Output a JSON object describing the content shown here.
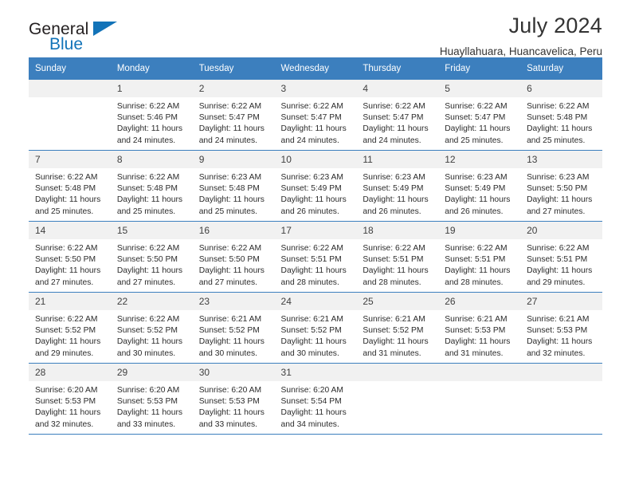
{
  "brand": {
    "name_top": "General",
    "name_bottom": "Blue",
    "flag_color": "#1273b8",
    "icon": "triangle-flag-icon"
  },
  "header": {
    "title": "July 2024",
    "subtitle": "Huayllahuara, Huancavelica, Peru"
  },
  "calendar": {
    "accent_color": "#3c7fbe",
    "daynum_background": "#f1f1f1",
    "weekday_headers": [
      "Sunday",
      "Monday",
      "Tuesday",
      "Wednesday",
      "Thursday",
      "Friday",
      "Saturday"
    ],
    "weeks": [
      [
        {
          "day": "",
          "blank": true,
          "sunrise": "",
          "sunset": "",
          "daylight_line1": "",
          "daylight_line2": ""
        },
        {
          "day": "1",
          "sunrise": "Sunrise: 6:22 AM",
          "sunset": "Sunset: 5:46 PM",
          "daylight_line1": "Daylight: 11 hours",
          "daylight_line2": "and 24 minutes."
        },
        {
          "day": "2",
          "sunrise": "Sunrise: 6:22 AM",
          "sunset": "Sunset: 5:47 PM",
          "daylight_line1": "Daylight: 11 hours",
          "daylight_line2": "and 24 minutes."
        },
        {
          "day": "3",
          "sunrise": "Sunrise: 6:22 AM",
          "sunset": "Sunset: 5:47 PM",
          "daylight_line1": "Daylight: 11 hours",
          "daylight_line2": "and 24 minutes."
        },
        {
          "day": "4",
          "sunrise": "Sunrise: 6:22 AM",
          "sunset": "Sunset: 5:47 PM",
          "daylight_line1": "Daylight: 11 hours",
          "daylight_line2": "and 24 minutes."
        },
        {
          "day": "5",
          "sunrise": "Sunrise: 6:22 AM",
          "sunset": "Sunset: 5:47 PM",
          "daylight_line1": "Daylight: 11 hours",
          "daylight_line2": "and 25 minutes."
        },
        {
          "day": "6",
          "sunrise": "Sunrise: 6:22 AM",
          "sunset": "Sunset: 5:48 PM",
          "daylight_line1": "Daylight: 11 hours",
          "daylight_line2": "and 25 minutes."
        }
      ],
      [
        {
          "day": "7",
          "sunrise": "Sunrise: 6:22 AM",
          "sunset": "Sunset: 5:48 PM",
          "daylight_line1": "Daylight: 11 hours",
          "daylight_line2": "and 25 minutes."
        },
        {
          "day": "8",
          "sunrise": "Sunrise: 6:22 AM",
          "sunset": "Sunset: 5:48 PM",
          "daylight_line1": "Daylight: 11 hours",
          "daylight_line2": "and 25 minutes."
        },
        {
          "day": "9",
          "sunrise": "Sunrise: 6:23 AM",
          "sunset": "Sunset: 5:48 PM",
          "daylight_line1": "Daylight: 11 hours",
          "daylight_line2": "and 25 minutes."
        },
        {
          "day": "10",
          "sunrise": "Sunrise: 6:23 AM",
          "sunset": "Sunset: 5:49 PM",
          "daylight_line1": "Daylight: 11 hours",
          "daylight_line2": "and 26 minutes."
        },
        {
          "day": "11",
          "sunrise": "Sunrise: 6:23 AM",
          "sunset": "Sunset: 5:49 PM",
          "daylight_line1": "Daylight: 11 hours",
          "daylight_line2": "and 26 minutes."
        },
        {
          "day": "12",
          "sunrise": "Sunrise: 6:23 AM",
          "sunset": "Sunset: 5:49 PM",
          "daylight_line1": "Daylight: 11 hours",
          "daylight_line2": "and 26 minutes."
        },
        {
          "day": "13",
          "sunrise": "Sunrise: 6:23 AM",
          "sunset": "Sunset: 5:50 PM",
          "daylight_line1": "Daylight: 11 hours",
          "daylight_line2": "and 27 minutes."
        }
      ],
      [
        {
          "day": "14",
          "sunrise": "Sunrise: 6:22 AM",
          "sunset": "Sunset: 5:50 PM",
          "daylight_line1": "Daylight: 11 hours",
          "daylight_line2": "and 27 minutes."
        },
        {
          "day": "15",
          "sunrise": "Sunrise: 6:22 AM",
          "sunset": "Sunset: 5:50 PM",
          "daylight_line1": "Daylight: 11 hours",
          "daylight_line2": "and 27 minutes."
        },
        {
          "day": "16",
          "sunrise": "Sunrise: 6:22 AM",
          "sunset": "Sunset: 5:50 PM",
          "daylight_line1": "Daylight: 11 hours",
          "daylight_line2": "and 27 minutes."
        },
        {
          "day": "17",
          "sunrise": "Sunrise: 6:22 AM",
          "sunset": "Sunset: 5:51 PM",
          "daylight_line1": "Daylight: 11 hours",
          "daylight_line2": "and 28 minutes."
        },
        {
          "day": "18",
          "sunrise": "Sunrise: 6:22 AM",
          "sunset": "Sunset: 5:51 PM",
          "daylight_line1": "Daylight: 11 hours",
          "daylight_line2": "and 28 minutes."
        },
        {
          "day": "19",
          "sunrise": "Sunrise: 6:22 AM",
          "sunset": "Sunset: 5:51 PM",
          "daylight_line1": "Daylight: 11 hours",
          "daylight_line2": "and 28 minutes."
        },
        {
          "day": "20",
          "sunrise": "Sunrise: 6:22 AM",
          "sunset": "Sunset: 5:51 PM",
          "daylight_line1": "Daylight: 11 hours",
          "daylight_line2": "and 29 minutes."
        }
      ],
      [
        {
          "day": "21",
          "sunrise": "Sunrise: 6:22 AM",
          "sunset": "Sunset: 5:52 PM",
          "daylight_line1": "Daylight: 11 hours",
          "daylight_line2": "and 29 minutes."
        },
        {
          "day": "22",
          "sunrise": "Sunrise: 6:22 AM",
          "sunset": "Sunset: 5:52 PM",
          "daylight_line1": "Daylight: 11 hours",
          "daylight_line2": "and 30 minutes."
        },
        {
          "day": "23",
          "sunrise": "Sunrise: 6:21 AM",
          "sunset": "Sunset: 5:52 PM",
          "daylight_line1": "Daylight: 11 hours",
          "daylight_line2": "and 30 minutes."
        },
        {
          "day": "24",
          "sunrise": "Sunrise: 6:21 AM",
          "sunset": "Sunset: 5:52 PM",
          "daylight_line1": "Daylight: 11 hours",
          "daylight_line2": "and 30 minutes."
        },
        {
          "day": "25",
          "sunrise": "Sunrise: 6:21 AM",
          "sunset": "Sunset: 5:52 PM",
          "daylight_line1": "Daylight: 11 hours",
          "daylight_line2": "and 31 minutes."
        },
        {
          "day": "26",
          "sunrise": "Sunrise: 6:21 AM",
          "sunset": "Sunset: 5:53 PM",
          "daylight_line1": "Daylight: 11 hours",
          "daylight_line2": "and 31 minutes."
        },
        {
          "day": "27",
          "sunrise": "Sunrise: 6:21 AM",
          "sunset": "Sunset: 5:53 PM",
          "daylight_line1": "Daylight: 11 hours",
          "daylight_line2": "and 32 minutes."
        }
      ],
      [
        {
          "day": "28",
          "sunrise": "Sunrise: 6:20 AM",
          "sunset": "Sunset: 5:53 PM",
          "daylight_line1": "Daylight: 11 hours",
          "daylight_line2": "and 32 minutes."
        },
        {
          "day": "29",
          "sunrise": "Sunrise: 6:20 AM",
          "sunset": "Sunset: 5:53 PM",
          "daylight_line1": "Daylight: 11 hours",
          "daylight_line2": "and 33 minutes."
        },
        {
          "day": "30",
          "sunrise": "Sunrise: 6:20 AM",
          "sunset": "Sunset: 5:53 PM",
          "daylight_line1": "Daylight: 11 hours",
          "daylight_line2": "and 33 minutes."
        },
        {
          "day": "31",
          "sunrise": "Sunrise: 6:20 AM",
          "sunset": "Sunset: 5:54 PM",
          "daylight_line1": "Daylight: 11 hours",
          "daylight_line2": "and 34 minutes."
        },
        {
          "day": "",
          "blank": true,
          "sunrise": "",
          "sunset": "",
          "daylight_line1": "",
          "daylight_line2": ""
        },
        {
          "day": "",
          "blank": true,
          "sunrise": "",
          "sunset": "",
          "daylight_line1": "",
          "daylight_line2": ""
        },
        {
          "day": "",
          "blank": true,
          "sunrise": "",
          "sunset": "",
          "daylight_line1": "",
          "daylight_line2": ""
        }
      ]
    ]
  }
}
